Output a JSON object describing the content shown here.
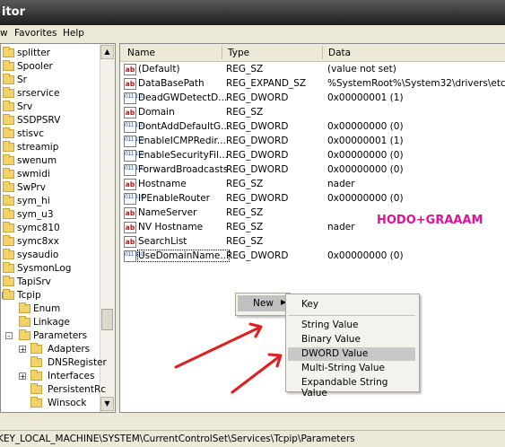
{
  "window": {
    "title": "itor"
  },
  "menu": [
    "w",
    "Favorites",
    "Help"
  ],
  "tree": [
    {
      "label": "splitter",
      "expander": false
    },
    {
      "label": "Spooler",
      "expander": false
    },
    {
      "label": "Sr",
      "expander": false
    },
    {
      "label": "srservice",
      "expander": false
    },
    {
      "label": "Srv",
      "expander": false
    },
    {
      "label": "SSDPSRV",
      "expander": false
    },
    {
      "label": "stisvc",
      "expander": false
    },
    {
      "label": "streamip",
      "expander": false
    },
    {
      "label": "swenum",
      "expander": false
    },
    {
      "label": "swmidi",
      "expander": false
    },
    {
      "label": "SwPrv",
      "expander": false
    },
    {
      "label": "sym_hi",
      "expander": false
    },
    {
      "label": "sym_u3",
      "expander": false
    },
    {
      "label": "symc810",
      "expander": false
    },
    {
      "label": "symc8xx",
      "expander": false
    },
    {
      "label": "sysaudio",
      "expander": false
    },
    {
      "label": "SysmonLog",
      "expander": false
    },
    {
      "label": "TapiSrv",
      "expander": false
    },
    {
      "label": "Tcpip",
      "expander": "-"
    },
    {
      "label": "Enum",
      "expander": false
    },
    {
      "label": "Linkage",
      "expander": false
    },
    {
      "label": "Parameters",
      "expander": "-"
    },
    {
      "label": "Adapters",
      "expander": "+"
    },
    {
      "label": "DNSRegister",
      "expander": false
    },
    {
      "label": "Interfaces",
      "expander": "+"
    },
    {
      "label": "PersistentRc",
      "expander": false
    },
    {
      "label": "Winsock",
      "expander": false
    }
  ],
  "columns": {
    "name": "Name",
    "type": "Type",
    "data": "Data"
  },
  "values": [
    {
      "icon": "sz",
      "name": "(Default)",
      "type": "REG_SZ",
      "data": "(value not set)"
    },
    {
      "icon": "sz",
      "name": "DataBasePath",
      "type": "REG_EXPAND_SZ",
      "data": "%SystemRoot%\\System32\\drivers\\etc"
    },
    {
      "icon": "dw",
      "name": "DeadGWDetectD...",
      "type": "REG_DWORD",
      "data": "0x00000001 (1)"
    },
    {
      "icon": "sz",
      "name": "Domain",
      "type": "REG_SZ",
      "data": ""
    },
    {
      "icon": "dw",
      "name": "DontAddDefaultG...",
      "type": "REG_DWORD",
      "data": "0x00000000 (0)"
    },
    {
      "icon": "dw",
      "name": "EnableICMPRedir...",
      "type": "REG_DWORD",
      "data": "0x00000001 (1)"
    },
    {
      "icon": "dw",
      "name": "EnableSecurityFil...",
      "type": "REG_DWORD",
      "data": "0x00000000 (0)"
    },
    {
      "icon": "dw",
      "name": "ForwardBroadcasts",
      "type": "REG_DWORD",
      "data": "0x00000000 (0)"
    },
    {
      "icon": "sz",
      "name": "Hostname",
      "type": "REG_SZ",
      "data": "nader"
    },
    {
      "icon": "dw",
      "name": "IPEnableRouter",
      "type": "REG_DWORD",
      "data": "0x00000000 (0)"
    },
    {
      "icon": "sz",
      "name": "NameServer",
      "type": "REG_SZ",
      "data": ""
    },
    {
      "icon": "sz",
      "name": "NV Hostname",
      "type": "REG_SZ",
      "data": "nader"
    },
    {
      "icon": "sz",
      "name": "SearchList",
      "type": "REG_SZ",
      "data": ""
    },
    {
      "icon": "dw",
      "name": "UseDomainName...",
      "type": "REG_DWORD",
      "data": "0x00000000 (0)"
    }
  ],
  "watermark": "HODO+GRAAAM",
  "context_menu": {
    "new_label": "New",
    "arrow": "▶"
  },
  "submenu": [
    "Key",
    "String Value",
    "Binary Value",
    "DWORD Value",
    "Multi-String Value",
    "Expandable String Value"
  ],
  "submenu_highlighted": "DWORD Value",
  "status": "KEY_LOCAL_MACHINE\\SYSTEM\\CurrentControlSet\\Services\\Tcpip\\Parameters",
  "colors": {
    "watermark": "#e0119a",
    "arrows": "#e01e1e",
    "highlight": "#c8c8c8"
  }
}
